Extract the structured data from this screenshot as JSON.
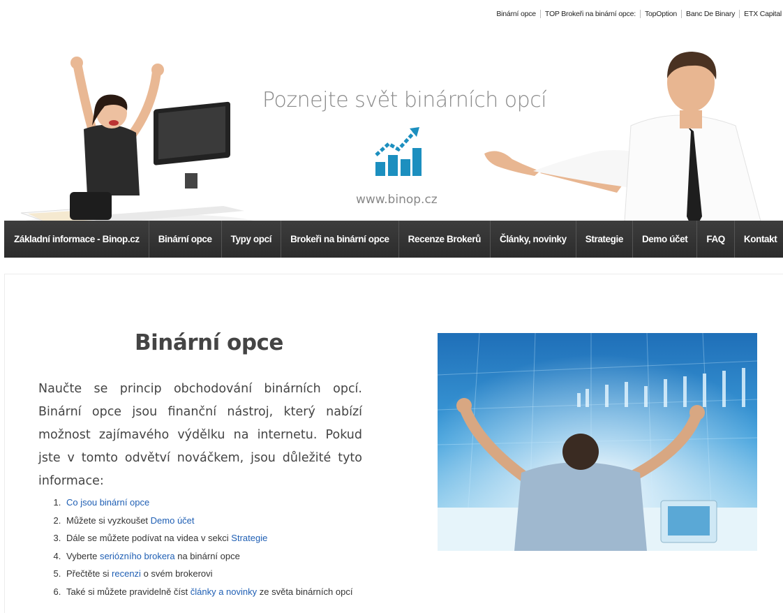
{
  "toplinks": [
    "Binární opce",
    "TOP Brokeři na binární opce:",
    "TopOption",
    "Banc De Binary",
    "ETX Capital"
  ],
  "header": {
    "title": "Poznejte svět binárních opcí",
    "url": "www.binop.cz",
    "logo_icon": "chart-growth-icon"
  },
  "nav": [
    "Základní informace - Binop.cz",
    "Binární opce",
    "Typy opcí",
    "Brokeři na binární opce",
    "Recenze Brokerů",
    "Články, novinky",
    "Strategie",
    "Demo účet",
    "FAQ",
    "Kontakt"
  ],
  "main": {
    "heading": "Binární opce",
    "intro": "Naučte se princip obchodování binárních opcí. Binární opce jsou finanční nástroj, který nabízí možnost zajímavého výdělku na internetu. Pokud jste v tomto odvětví nováčkem, jsou důležité tyto informace:",
    "steps": [
      {
        "pre": "",
        "link": "Co jsou binární opce",
        "post": ""
      },
      {
        "pre": "Můžete si vyzkoušet ",
        "link": "Demo účet",
        "post": ""
      },
      {
        "pre": "Dále se můžete podívat na videa v sekci ",
        "link": "Strategie",
        "post": ""
      },
      {
        "pre": "Vyberte ",
        "link": "seriózního brokera",
        "post": " na binární opce"
      },
      {
        "pre": "Přečtěte si ",
        "link": "recenzi",
        "post": " o svém brokerovi"
      },
      {
        "pre": "Také si můžete pravidelně číst ",
        "link": "články a novinky",
        "post": " ze světa binárních opcí"
      }
    ]
  },
  "colors": {
    "nav_bg": "#333333",
    "link": "#1f5fb4",
    "logo": "#1c8fbf"
  }
}
